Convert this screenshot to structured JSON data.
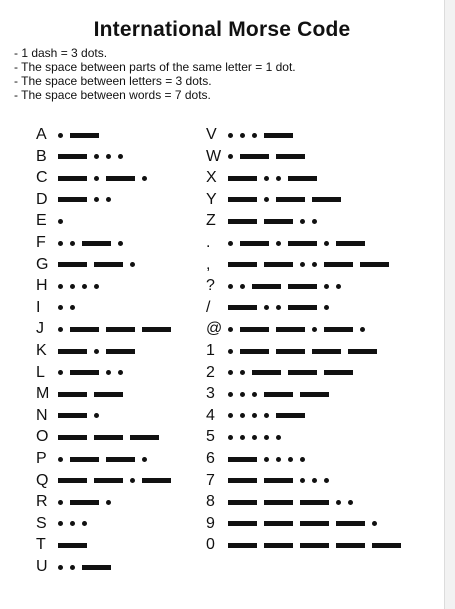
{
  "title": "International Morse Code",
  "notes": [
    "- 1 dash = 3 dots.",
    "- The space between parts of the same letter = 1 dot.",
    "- The space between letters = 3 dots.",
    "- The space between words = 7 dots."
  ],
  "left_column": [
    {
      "char": "A",
      "code": ".-"
    },
    {
      "char": "B",
      "code": "-..."
    },
    {
      "char": "C",
      "code": "-.-."
    },
    {
      "char": "D",
      "code": "-.."
    },
    {
      "char": "E",
      "code": "."
    },
    {
      "char": "F",
      "code": "..-."
    },
    {
      "char": "G",
      "code": "--."
    },
    {
      "char": "H",
      "code": "...."
    },
    {
      "char": "I",
      "code": ".."
    },
    {
      "char": "J",
      "code": ".---"
    },
    {
      "char": "K",
      "code": "-.-"
    },
    {
      "char": "L",
      "code": ".-.."
    },
    {
      "char": "M",
      "code": "--"
    },
    {
      "char": "N",
      "code": "-."
    },
    {
      "char": "O",
      "code": "---"
    },
    {
      "char": "P",
      "code": ".--."
    },
    {
      "char": "Q",
      "code": "--.-"
    },
    {
      "char": "R",
      "code": ".-."
    },
    {
      "char": "S",
      "code": "..."
    },
    {
      "char": "T",
      "code": "-"
    },
    {
      "char": "U",
      "code": "..-"
    }
  ],
  "right_column": [
    {
      "char": "V",
      "code": "...-"
    },
    {
      "char": "W",
      "code": ".--"
    },
    {
      "char": "X",
      "code": "-..-"
    },
    {
      "char": "Y",
      "code": "-.--"
    },
    {
      "char": "Z",
      "code": "--.."
    },
    {
      "char": ".",
      "code": ".-.-.-"
    },
    {
      "char": ",",
      "code": "--..--"
    },
    {
      "char": "?",
      "code": "..--.."
    },
    {
      "char": "/",
      "code": "-..-."
    },
    {
      "char": "@",
      "code": ".--.-."
    },
    {
      "char": "1",
      "code": ".----"
    },
    {
      "char": "2",
      "code": "..---"
    },
    {
      "char": "3",
      "code": "...--"
    },
    {
      "char": "4",
      "code": "....-"
    },
    {
      "char": "5",
      "code": "....."
    },
    {
      "char": "6",
      "code": "-...."
    },
    {
      "char": "7",
      "code": "--..."
    },
    {
      "char": "8",
      "code": "---.."
    },
    {
      "char": "9",
      "code": "----."
    },
    {
      "char": "0",
      "code": "-----"
    }
  ]
}
